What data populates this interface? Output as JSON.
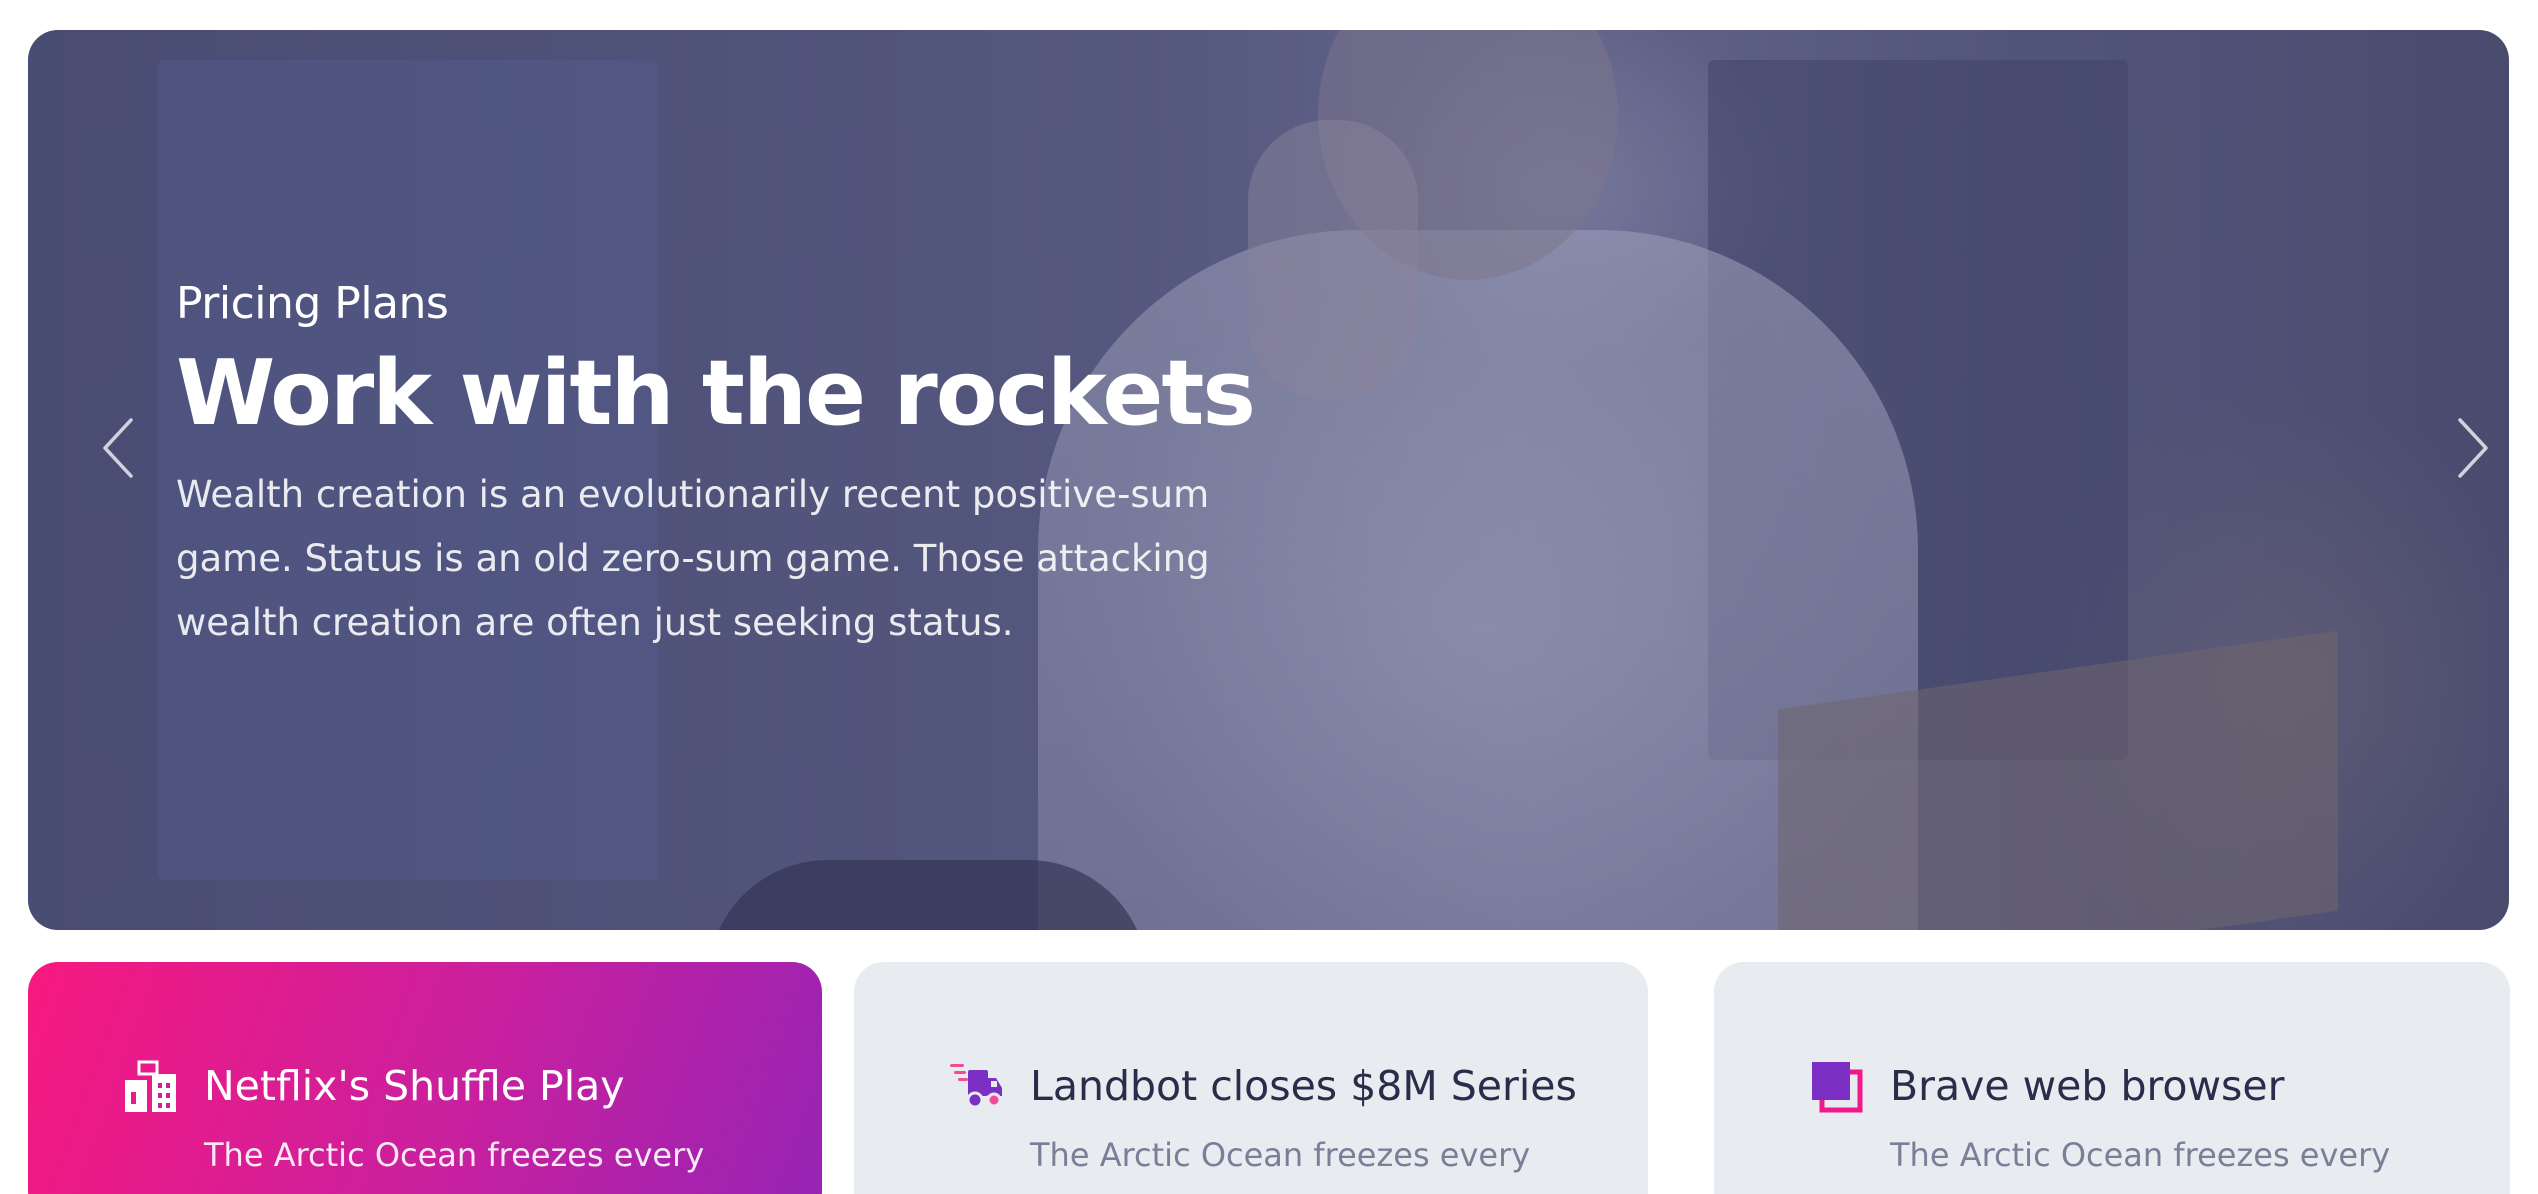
{
  "hero": {
    "kicker": "Pricing Plans",
    "title": "Work with the rockets",
    "text": "Wealth creation is an evolutionarily recent positive-sum game. Status is an old zero-sum game. Those attacking wealth creation are often just seeking status.",
    "prev_icon": "chevron-left-icon",
    "next_icon": "chevron-right-icon"
  },
  "cards": [
    {
      "icon": "building-icon",
      "title": "Netflix's Shuffle Play",
      "text": "The Arctic Ocean freezes every",
      "background": [
        "#f7197f",
        "#9624b5"
      ]
    },
    {
      "icon": "delivery-truck-icon",
      "title": "Landbot closes $8M Series",
      "text": "The Arctic Ocean freezes every",
      "background": "#e8ebef"
    },
    {
      "icon": "layers-icon",
      "title": "Brave web browser",
      "text": "The Arctic Ocean freezes every",
      "background": "#e8ebef"
    }
  ],
  "colors": {
    "accent_pink": "#f7197f",
    "accent_purple": "#7b2fc4",
    "title_dark": "#2a2d4a",
    "muted_text": "#7a7f98"
  }
}
